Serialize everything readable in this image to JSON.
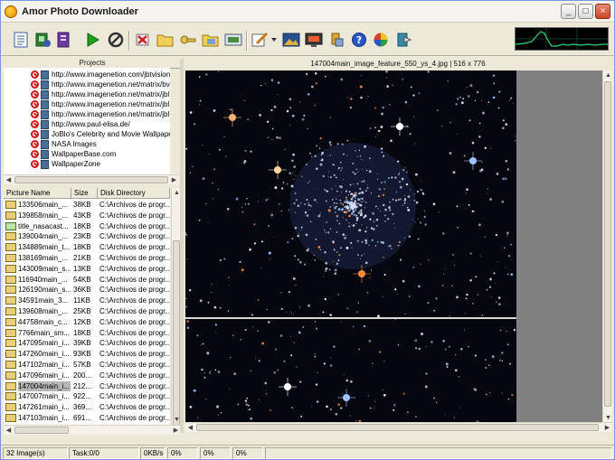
{
  "window": {
    "title": "Amor Photo Downloader"
  },
  "window_buttons": {
    "minimize": "_",
    "maximize": "□",
    "close": "×"
  },
  "toolbar": {
    "icons": [
      "new-project-icon",
      "download-icon",
      "properties-icon",
      "start-icon",
      "stop-icon",
      "delete-icon",
      "open-folder-icon",
      "key-icon",
      "folder-open-icon",
      "slideshow-icon",
      "edit-icon",
      "wallpaper-icon",
      "screensaver-icon",
      "settings-icon",
      "help-icon",
      "web-icon",
      "exit-icon"
    ],
    "colors": {
      "start": "#19a319",
      "stop": "#333333",
      "help": "#2457c5"
    }
  },
  "projects": {
    "header": "Projects",
    "items": [
      "http://www.imagenetion.com/jbtvision",
      "http://www.imagenetion.net/matrix/bv",
      "http://www.imagenetion.net/matrix/jbl",
      "http://www.imagenetion.net/matrix/jbl",
      "http://www.imagenetion.net/matrix/jbl",
      "http://www.paul-elisa.de/",
      "JoBlo's Celebrity and Movie Wallpape",
      "NASA Images",
      "WallpaperBase.com",
      "WallpaperZone"
    ]
  },
  "files": {
    "headers": [
      "Picture Name",
      "Size",
      "Disk Directory"
    ],
    "rows": [
      [
        "133506main_...",
        "38KB",
        "C:\\Archivos de progr..."
      ],
      [
        "139858main_...",
        "43KB",
        "C:\\Archivos de progr..."
      ],
      [
        "title_nasacast...",
        "18KB",
        "C:\\Archivos de progr..."
      ],
      [
        "139004main_...",
        "23KB",
        "C:\\Archivos de progr..."
      ],
      [
        "134889main_t...",
        "18KB",
        "C:\\Archivos de progr..."
      ],
      [
        "138169main_...",
        "21KB",
        "C:\\Archivos de progr..."
      ],
      [
        "143009main_s...",
        "13KB",
        "C:\\Archivos de progr..."
      ],
      [
        "116940main_...",
        "54KB",
        "C:\\Archivos de progr..."
      ],
      [
        "126190main_s...",
        "36KB",
        "C:\\Archivos de progr..."
      ],
      [
        "34591main_3...",
        "11KB",
        "C:\\Archivos de progr..."
      ],
      [
        "139608main_...",
        "25KB",
        "C:\\Archivos de progr..."
      ],
      [
        "44758main_c...",
        "12KB",
        "C:\\Archivos de progr..."
      ],
      [
        "7766main_sm...",
        "18KB",
        "C:\\Archivos de progr..."
      ],
      [
        "147095main_i...",
        "39KB",
        "C:\\Archivos de progr..."
      ],
      [
        "147260main_i...",
        "93KB",
        "C:\\Archivos de progr..."
      ],
      [
        "147102main_i...",
        "57KB",
        "C:\\Archivos de progr..."
      ],
      [
        "147096main_i...",
        "200...",
        "C:\\Archivos de progr..."
      ],
      [
        "147004main_i...",
        "212...",
        "C:\\Archivos de progr..."
      ],
      [
        "147007main_i...",
        "922...",
        "C:\\Archivos de progr..."
      ],
      [
        "147261main_i...",
        "369...",
        "C:\\Archivos de progr..."
      ],
      [
        "147103main_i...",
        "691...",
        "C:\\Archivos de progr..."
      ]
    ],
    "selected_index": 17
  },
  "image": {
    "title": "147004main_image_feature_550_ys_4.jpg | 516 x 776",
    "colors": {
      "sky": "#05070f",
      "star": "#dfe8ff",
      "warm": "#ff8a4a"
    }
  },
  "status": {
    "images": "32 Image(s)",
    "task": "Task:0/0",
    "speed": "0KB/s",
    "p1": "0%",
    "p2": "0%",
    "p3": "0%"
  }
}
